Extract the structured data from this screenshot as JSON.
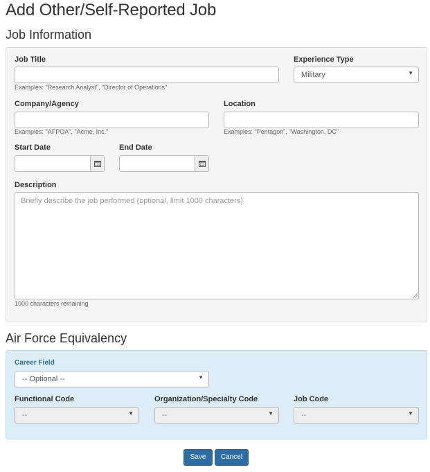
{
  "page": {
    "title": "Add Other/Self-Reported Job"
  },
  "job_info": {
    "section_title": "Job Information",
    "job_title": {
      "label": "Job Title",
      "value": "",
      "help": "Examples: \"Research Analyst\", \"Director of Operations\""
    },
    "experience_type": {
      "label": "Experience Type",
      "selected": "Military"
    },
    "company": {
      "label": "Company/Agency",
      "value": "",
      "help": "Examples: \"AFPOA\", \"Acme, Inc.\""
    },
    "location": {
      "label": "Location",
      "value": "",
      "help": "Examples: \"Pentagon\", \"Washington, DC\""
    },
    "start_date": {
      "label": "Start Date",
      "value": ""
    },
    "end_date": {
      "label": "End Date",
      "value": ""
    },
    "description": {
      "label": "Description",
      "placeholder": "Briefly describe the job performed (optional, limit 1000 characters)",
      "remaining": "1000 characters remaining"
    }
  },
  "af_equiv": {
    "section_title": "Air Force Equivalency",
    "career_field": {
      "label": "Career Field",
      "selected": "-- Optional --"
    },
    "functional_code": {
      "label": "Functional Code",
      "selected": "--"
    },
    "org_specialty_code": {
      "label": "Organization/Specialty Code",
      "selected": "--"
    },
    "job_code": {
      "label": "Job Code",
      "selected": "--"
    }
  },
  "actions": {
    "save_label": "Save",
    "cancel_label": "Cancel"
  },
  "icons": {
    "calendar": "calendar-icon",
    "dropdown": "caret-down-icon"
  },
  "colors": {
    "primary": "#2e6da4",
    "info_panel": "#dcedf7",
    "panel": "#f5f5f5"
  }
}
